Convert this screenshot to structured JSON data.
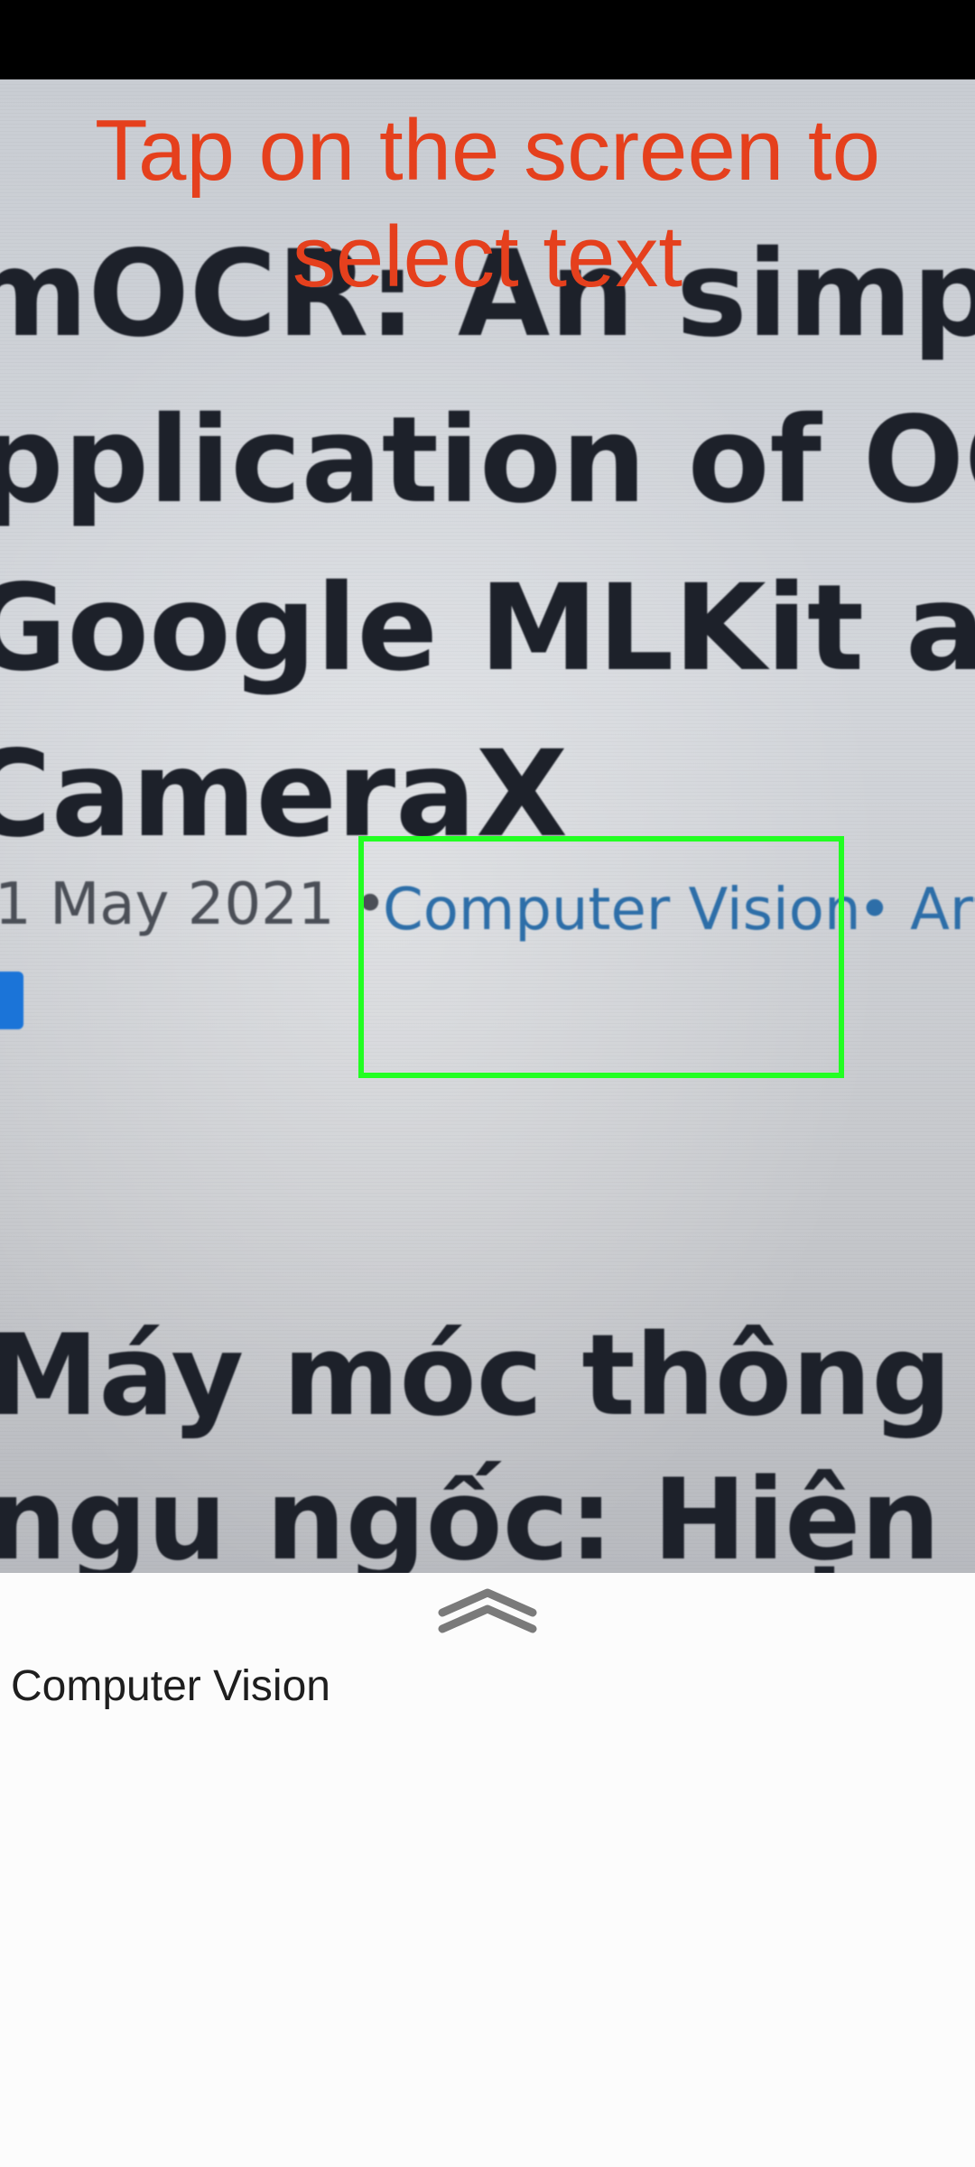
{
  "camera": {
    "headline_lines": [
      "mOCR: An simple",
      "pplication of OC",
      "Google MLKit and",
      "CameraX"
    ],
    "meta": {
      "date": "1 May 2021 •",
      "category": "Computer Vision",
      "separator": "• Art"
    },
    "body_lines": [
      "Máy móc thông mi",
      "ngu ngốc: Hiện trạ"
    ]
  },
  "overlay": {
    "hint": "Tap on the screen to select text"
  },
  "selection": {
    "color": "#22ff22"
  },
  "panel": {
    "expand_icon": "double-chevron-up-icon",
    "result_text": "Computer Vision"
  },
  "colors": {
    "hint": "#e5401d",
    "link": "#2d6ea8",
    "status_bar": "#000000"
  }
}
